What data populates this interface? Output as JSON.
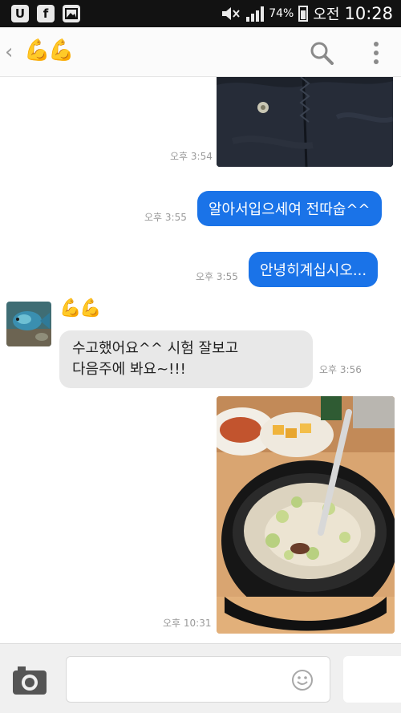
{
  "status_bar": {
    "left_icons": [
      "update-icon",
      "facebook-icon",
      "gallery-icon"
    ],
    "battery": "74%",
    "ampm": "오전",
    "time": "10:28"
  },
  "header": {
    "back_icon": "chevron-left-icon",
    "contact_name": "💪💪",
    "actions": [
      "search-icon",
      "more-vertical-icon"
    ]
  },
  "chat": {
    "messages": [
      {
        "type": "photo-sent",
        "time": "오후 3:54",
        "photo": "person-in-black-jacket"
      },
      {
        "type": "text-sent",
        "text": "알아서입으세여 전따숩^^",
        "time": "오후 3:55"
      },
      {
        "type": "text-sent",
        "text": "안녕히계십시오...",
        "time": "오후 3:55"
      },
      {
        "type": "text-received",
        "sender": "💪💪",
        "text": "수고했어요^^ 시험 잘보고\n다음주에 봐요~!!!",
        "time": "오후 3:56"
      },
      {
        "type": "photo-sent",
        "time": "오후 10:31",
        "photo": "korean-soup-with-side-dishes"
      }
    ]
  },
  "input_bar": {
    "camera_icon": "camera-icon",
    "emoji_icon": "emoji-icon",
    "placeholder": ""
  },
  "colors": {
    "sent_bubble": "#1a73e8",
    "received_bubble": "#e8e8e8",
    "status_bar": "#121212",
    "name_accent": "#d7a05a"
  }
}
